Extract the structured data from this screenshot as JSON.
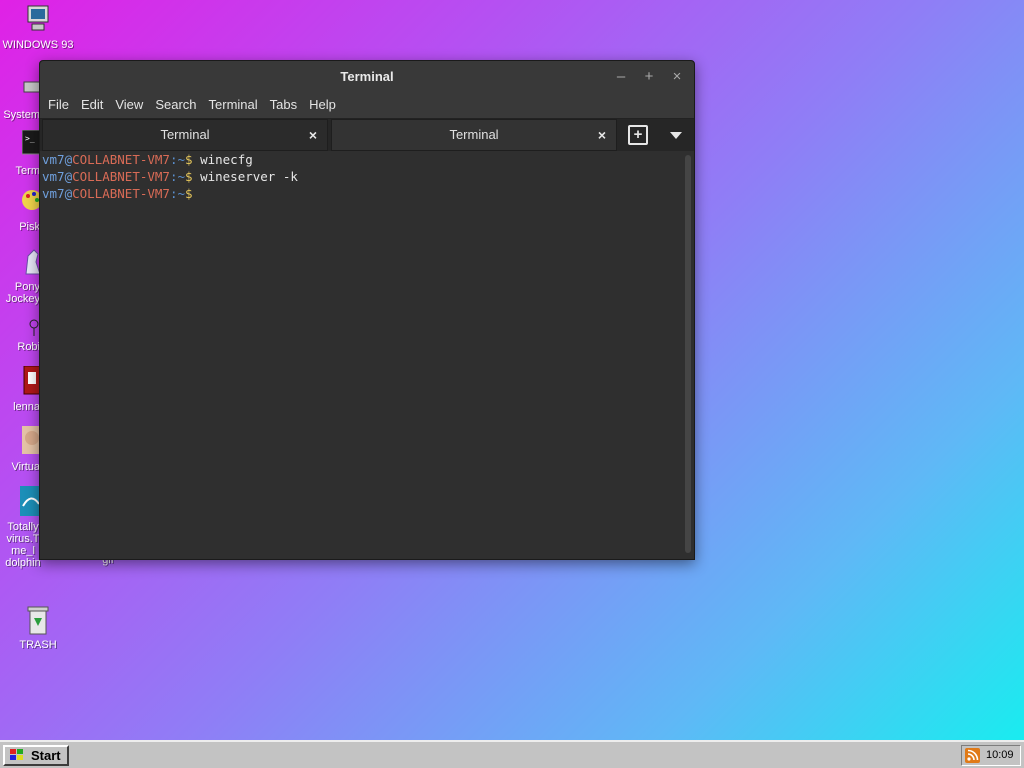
{
  "desktop": {
    "icons": [
      {
        "label": "WINDOWS 93"
      },
      {
        "label": "System"
      },
      {
        "label": "Term"
      },
      {
        "label": "Pisk"
      },
      {
        "label": "Pony Jockey"
      },
      {
        "label": "Robi"
      },
      {
        "label": "lenna"
      },
      {
        "label": "Virtua"
      },
      {
        "label": "Totally virus.T me_l dolphin"
      },
      {
        "label": "gif"
      },
      {
        "label": "TRASH"
      }
    ]
  },
  "terminal_window": {
    "title": "Terminal",
    "buttons": {
      "minimize": "–",
      "maximize": "+",
      "close": "×"
    },
    "menu": [
      "File",
      "Edit",
      "View",
      "Search",
      "Terminal",
      "Tabs",
      "Help"
    ],
    "tabs": [
      {
        "label": "Terminal",
        "close": "×"
      },
      {
        "label": "Terminal",
        "close": "×"
      }
    ],
    "new_tab_symbol": "+",
    "lines": [
      {
        "user": "vm7",
        "at": "@",
        "host": "COLLABNET-VM7",
        "colon": ":",
        "path": "~",
        "dollar": "$",
        "cmd": " winecfg"
      },
      {
        "user": "vm7",
        "at": "@",
        "host": "COLLABNET-VM7",
        "colon": ":",
        "path": "~",
        "dollar": "$",
        "cmd": " wineserver -k"
      },
      {
        "user": "vm7",
        "at": "@",
        "host": "COLLABNET-VM7",
        "colon": ":",
        "path": "~",
        "dollar": "$",
        "cmd": ""
      }
    ]
  },
  "taskbar": {
    "start_label": "Start",
    "clock": "10:09"
  },
  "colors": {
    "prompt_user": "#6f9fdc",
    "prompt_host": "#d96b56",
    "prompt_dollar": "#e6c75c",
    "terminal_bg": "#2f2f2f"
  }
}
